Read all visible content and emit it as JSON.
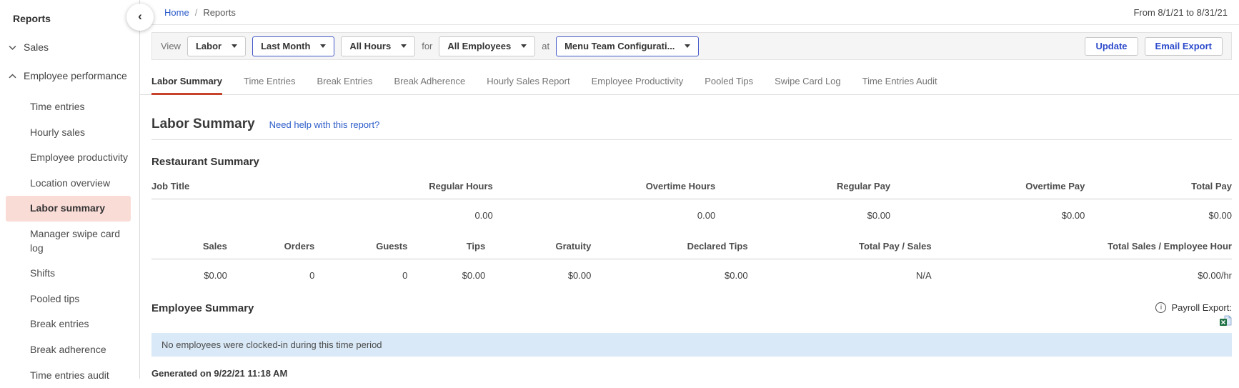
{
  "colors": {
    "accent-red": "#c7432b",
    "selected-pink": "#fadcd7",
    "link-blue": "#2b5bc9",
    "button-blue": "#2b4acb",
    "focus-border": "#4559c9",
    "banner-blue": "#d9e9f7",
    "panel-gray": "#f5f5f5",
    "excel-green": "#217346"
  },
  "icons": {
    "collapse_glyph": "‹",
    "info_glyph": "i",
    "names": [
      "chevron-left-icon",
      "chevron-down-icon",
      "chevron-up-icon",
      "caret-down-icon",
      "info-circle-icon",
      "excel-file-icon"
    ]
  },
  "header": {
    "breadcrumb": {
      "home": "Home",
      "separator": "/",
      "current": "Reports"
    },
    "date_range": "From 8/1/21 to 8/31/21"
  },
  "sidebar": {
    "title": "Reports",
    "sales_section": {
      "label": "Sales",
      "state": "collapsed"
    },
    "employee_section": {
      "label": "Employee performance",
      "state": "expanded"
    },
    "items": [
      {
        "label": "Time entries"
      },
      {
        "label": "Hourly sales"
      },
      {
        "label": "Employee productivity"
      },
      {
        "label": "Location overview"
      },
      {
        "label": "Labor summary",
        "selected": true
      },
      {
        "label": "Manager swipe card log"
      },
      {
        "label": "Shifts"
      },
      {
        "label": "Pooled tips"
      },
      {
        "label": "Break entries"
      },
      {
        "label": "Break adherence"
      },
      {
        "label": "Time entries audit"
      }
    ]
  },
  "filter_bar": {
    "view_label": "View",
    "report_type": "Labor",
    "date_preset": "Last Month",
    "hours": "All Hours",
    "for_label": "for",
    "employees": "All Employees",
    "at_label": "at",
    "team_config": "Menu Team Configurati...",
    "update_button": "Update",
    "email_export_button": "Email Export"
  },
  "tabs": [
    {
      "label": "Labor Summary",
      "active": true
    },
    {
      "label": "Time Entries"
    },
    {
      "label": "Break Entries"
    },
    {
      "label": "Break Adherence"
    },
    {
      "label": "Hourly Sales Report"
    },
    {
      "label": "Employee Productivity"
    },
    {
      "label": "Pooled Tips"
    },
    {
      "label": "Swipe Card Log"
    },
    {
      "label": "Time Entries Audit"
    }
  ],
  "report": {
    "title": "Labor Summary",
    "help_link": "Need help with this report?",
    "restaurant_summary_heading": "Restaurant Summary",
    "labor_table": {
      "headers": [
        "Job Title",
        "Regular Hours",
        "Overtime Hours",
        "Regular Pay",
        "Overtime Pay",
        "Total Pay"
      ],
      "row": [
        "",
        "0.00",
        "0.00",
        "$0.00",
        "$0.00",
        "$0.00"
      ]
    },
    "sales_table": {
      "headers": [
        "Sales",
        "Orders",
        "Guests",
        "Tips",
        "Gratuity",
        "Declared Tips",
        "Total Pay / Sales",
        "Total Sales / Employee Hour"
      ],
      "row": [
        "$0.00",
        "0",
        "0",
        "$0.00",
        "$0.00",
        "$0.00",
        "N/A",
        "$0.00/hr"
      ]
    },
    "employee_summary_heading": "Employee Summary",
    "payroll_export_label": "Payroll Export:",
    "empty_message": "No employees were clocked-in during this time period",
    "generated_text": "Generated on 9/22/21 11:18 AM"
  }
}
